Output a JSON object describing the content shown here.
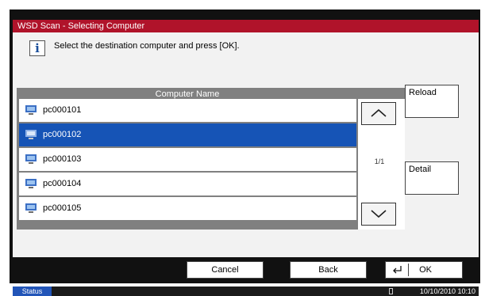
{
  "window": {
    "title": "WSD Scan - Selecting Computer"
  },
  "info": {
    "icon": "info-icon",
    "message": "Select the destination computer and press [OK]."
  },
  "list": {
    "header": "Computer Name",
    "rows": [
      {
        "name": "pc000101",
        "selected": false
      },
      {
        "name": "pc000102",
        "selected": true
      },
      {
        "name": "pc000103",
        "selected": false
      },
      {
        "name": "pc000104",
        "selected": false
      },
      {
        "name": "pc000105",
        "selected": false
      }
    ],
    "page_indicator": "1/1"
  },
  "buttons": {
    "reload": "Reload",
    "detail": "Detail",
    "cancel": "Cancel",
    "back": "Back",
    "ok": "OK"
  },
  "status": {
    "label": "Status",
    "datetime": "10/10/2010  10:10"
  },
  "colors": {
    "title_bar": "#b0132a",
    "selected_row": "#1654b6",
    "status_label": "#2255b8"
  }
}
